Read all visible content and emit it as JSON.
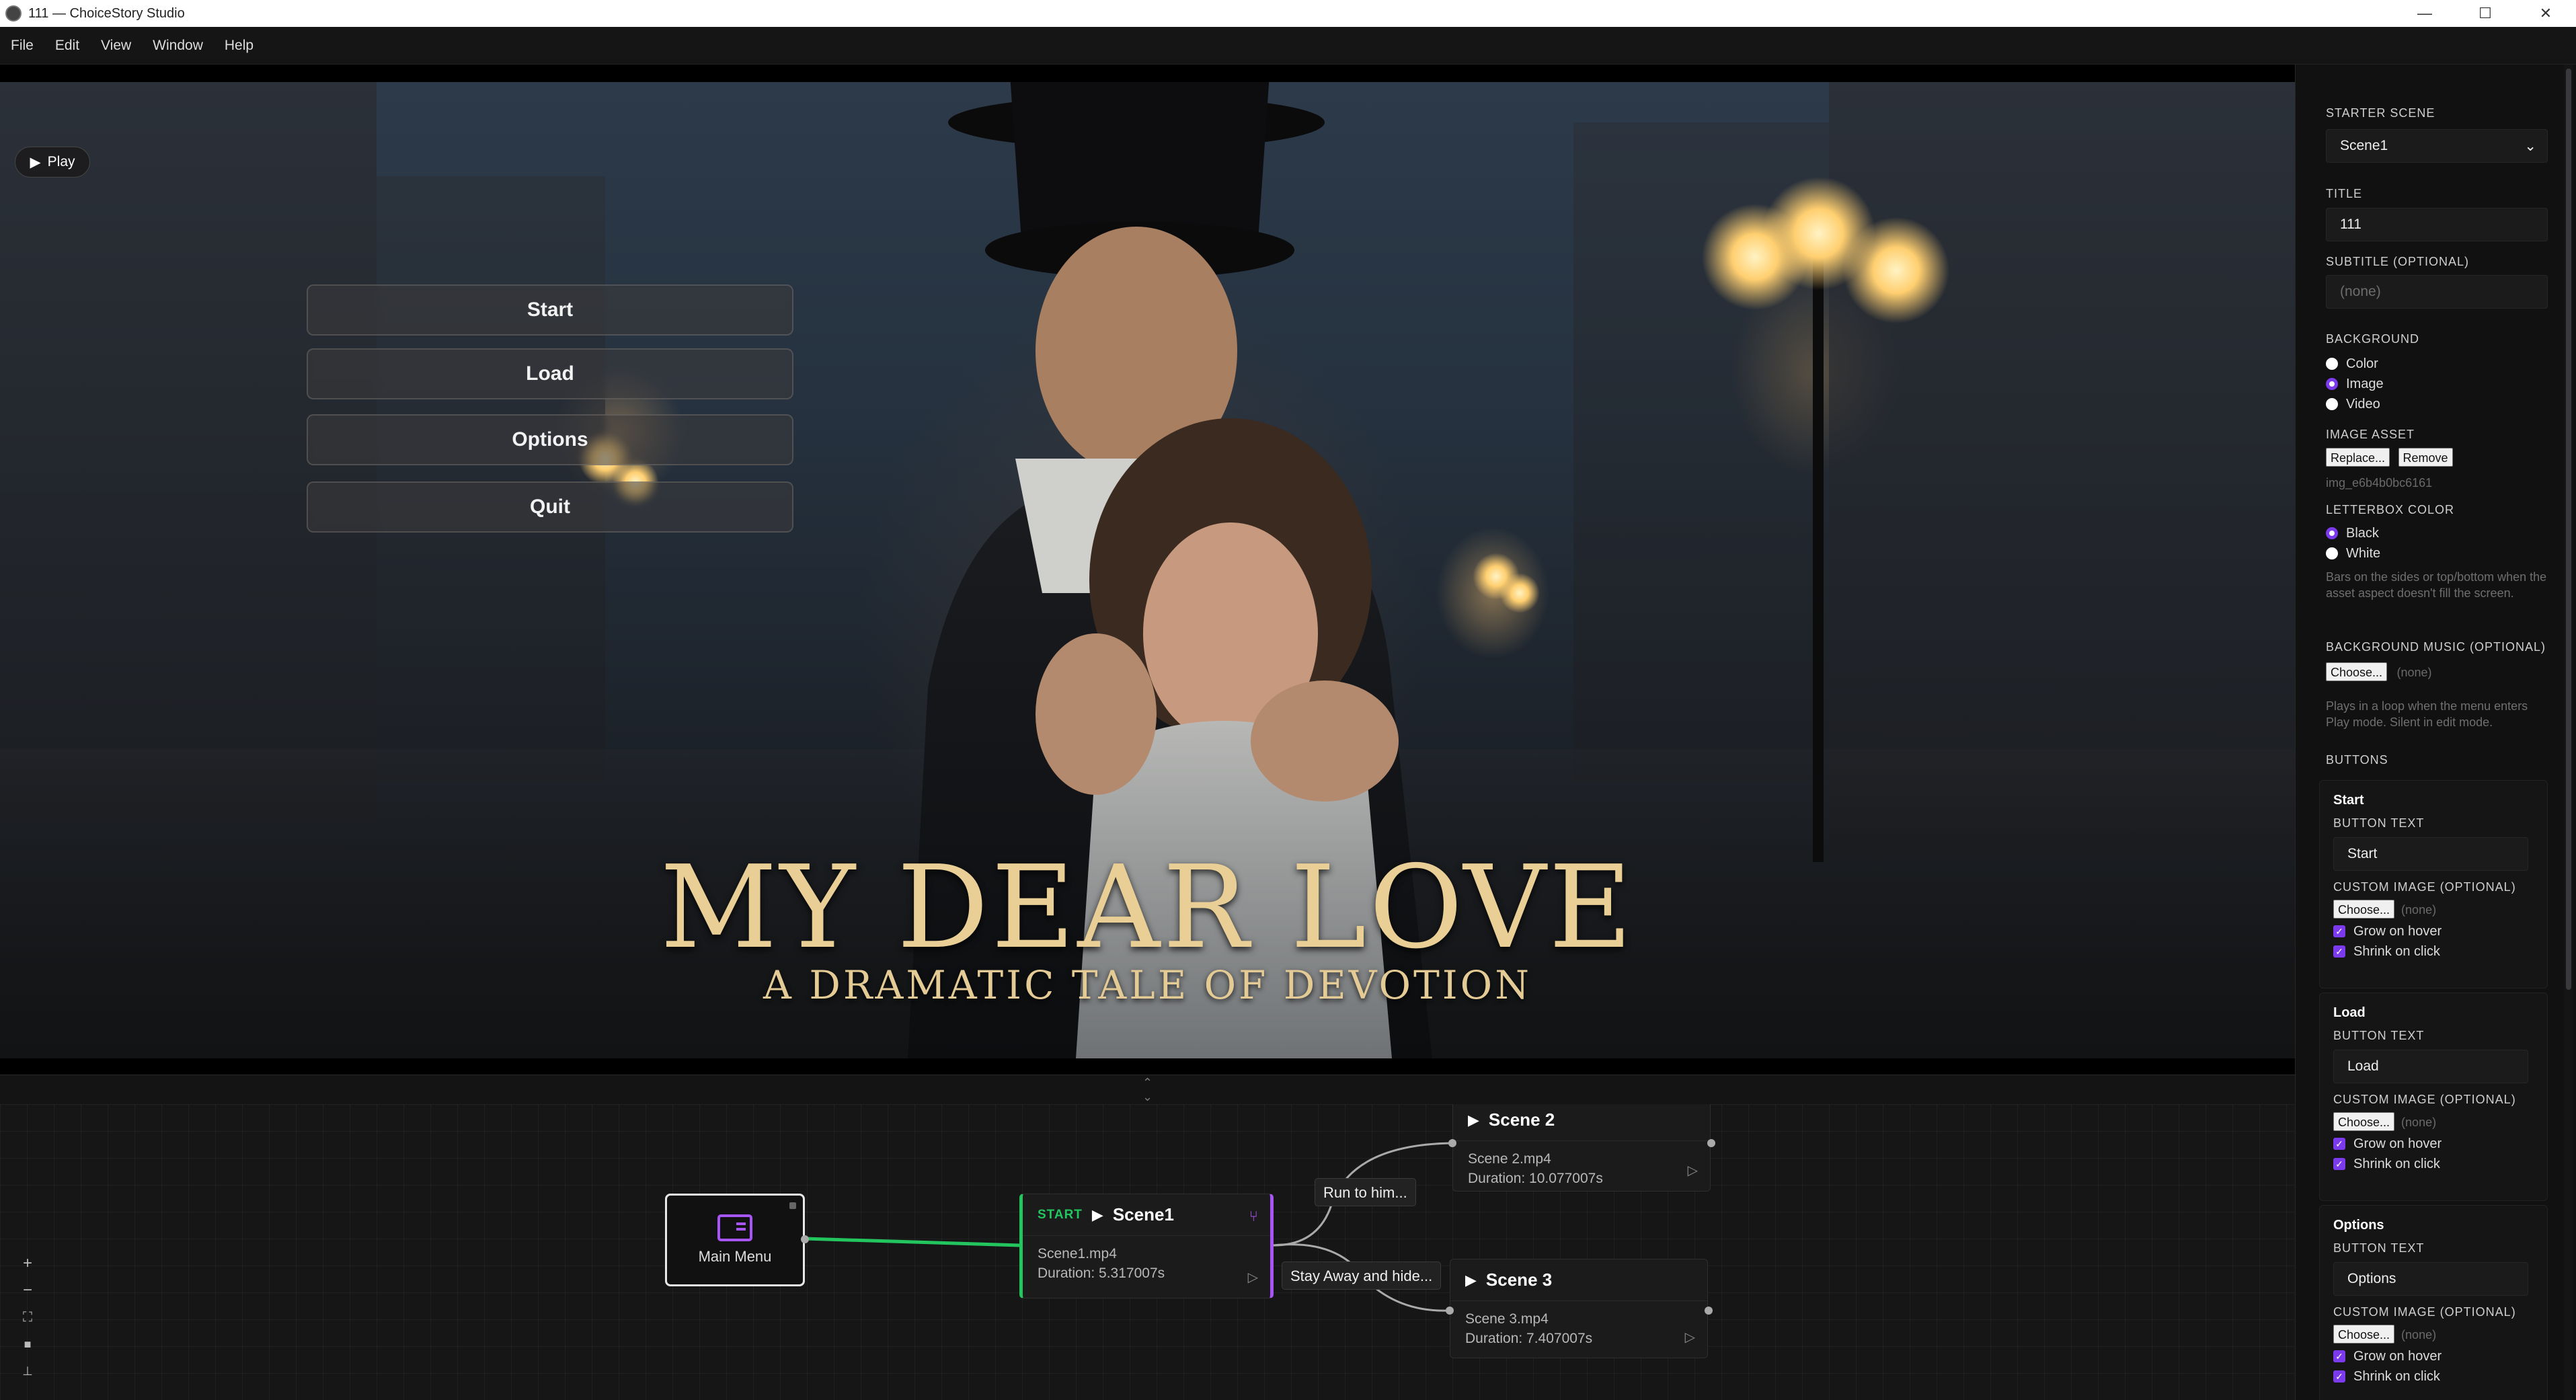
{
  "window": {
    "title": "111 — ChoiceStory Studio"
  },
  "menu": [
    "File",
    "Edit",
    "View",
    "Window",
    "Help"
  ],
  "preview": {
    "play_label": "Play",
    "menu_buttons": [
      "Start",
      "Load",
      "Options",
      "Quit"
    ],
    "title": "MY DEAR LOVE",
    "subtitle": "A DRAMATIC TALE OF DEVOTION"
  },
  "graph": {
    "main_menu_label": "Main Menu",
    "scene1": {
      "badge": "START",
      "name": "Scene1",
      "file": "Scene1.mp4",
      "duration": "Duration: 5.317007s"
    },
    "scene2": {
      "name": "Scene 2",
      "file": "Scene 2.mp4",
      "duration": "Duration: 10.077007s"
    },
    "scene3": {
      "name": "Scene 3",
      "file": "Scene 3.mp4",
      "duration": "Duration: 7.407007s"
    },
    "choices": [
      "Run to him...",
      "Stay Away and hide..."
    ]
  },
  "panel": {
    "starter_scene_label": "STARTER SCENE",
    "starter_scene_value": "Scene1",
    "title_label": "TITLE",
    "title_value": "111",
    "subtitle_label": "SUBTITLE (OPTIONAL)",
    "subtitle_placeholder": "(none)",
    "background_label": "BACKGROUND",
    "background_options": [
      "Color",
      "Image",
      "Video"
    ],
    "background_selected": "Image",
    "image_asset_label": "IMAGE ASSET",
    "replace_label": "Replace...",
    "remove_label": "Remove",
    "asset_id": "img_e6b4b0bc6161",
    "letterbox_label": "LETTERBOX COLOR",
    "letterbox_options": [
      "Black",
      "White"
    ],
    "letterbox_selected": "Black",
    "letterbox_hint": "Bars on the sides or top/bottom when the asset aspect doesn't fill the screen.",
    "music_label": "BACKGROUND MUSIC (OPTIONAL)",
    "choose_label": "Choose...",
    "none_label": "(none)",
    "music_hint": "Plays in a loop when the menu enters Play mode. Silent in edit mode.",
    "buttons_label": "BUTTONS",
    "button_text_label": "BUTTON TEXT",
    "custom_image_label": "CUSTOM IMAGE (OPTIONAL)",
    "grow_label": "Grow on hover",
    "shrink_label": "Shrink on click",
    "buttons": [
      {
        "name": "Start",
        "text": "Start"
      },
      {
        "name": "Load",
        "text": "Load"
      },
      {
        "name": "Options",
        "text": "Options"
      }
    ]
  },
  "colors": {
    "accent": "#a855f7",
    "start_green": "#22c55e",
    "title_gold": "#e9cf95"
  }
}
